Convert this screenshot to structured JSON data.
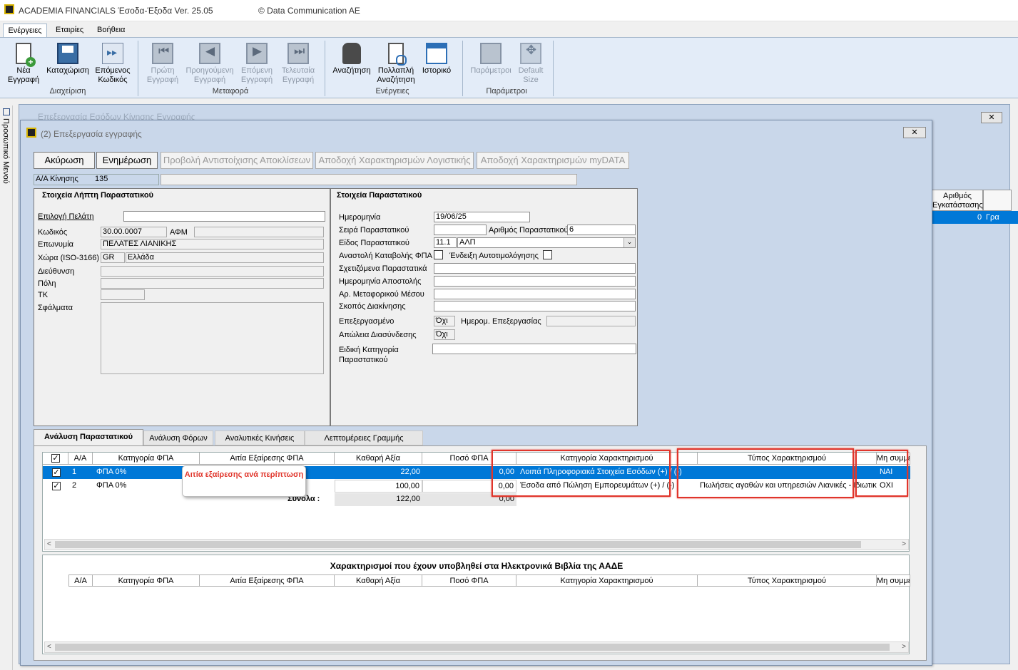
{
  "window": {
    "app_title": "ACADEMIA FINANCIALS Έσοδα-Έξοδα Ver. 25.05",
    "copyright": "© Data Communication AE"
  },
  "menu_tabs": [
    "Ενέργειες",
    "Εταιρίες",
    "Βοήθεια"
  ],
  "ribbon": {
    "new_record": [
      "Νέα",
      "Εγγραφή"
    ],
    "save": "Καταχώριση",
    "next_code": [
      "Επόμενος",
      "Κωδικός"
    ],
    "group_management": "Διαχείριση",
    "first": [
      "Πρώτη",
      "Εγγραφή"
    ],
    "previous": [
      "Προηγούμενη",
      "Εγγραφή"
    ],
    "next": [
      "Επόμενη",
      "Εγγραφή"
    ],
    "last": [
      "Τελευταία",
      "Εγγραφή"
    ],
    "group_navigation": "Μεταφορά",
    "search": "Αναζήτηση",
    "multi_search": [
      "Πολλαπλή",
      "Αναζήτηση"
    ],
    "history": "Ιστορικό",
    "group_actions": "Ενέργειες",
    "parameters": "Παράμετροι",
    "default_size": [
      "Default",
      "Size"
    ],
    "group_parameters": "Παράμετροι"
  },
  "sidebar": {
    "label": "Προσωπικό Μενού"
  },
  "background_window": {
    "title": "Επεξεργασία Εσόδων Κίνησης Εγγραφής",
    "col_header": [
      "Αριθμός",
      "Εγκατάστασης"
    ],
    "row_value": "0",
    "row_extra": "Γρα"
  },
  "edit_window": {
    "title": "(2) Επεξεργασία εγγραφής",
    "buttons": {
      "cancel": "Ακύρωση",
      "update": "Ενημέρωση",
      "view_matching": "Προβολή Αντιστοίχισης Αποκλίσεων",
      "accept_accounting": "Αποδοχή Χαρακτηρισμών Λογιστικής",
      "accept_mydata": "Αποδοχή Χαρακτηρισμών myDATA"
    },
    "movement_label": "Α/Α Κίνησης",
    "movement_value": "135",
    "recipient": {
      "title": "Στοιχεία Λήπτη Παραστατικού",
      "select_customer": "Επιλογή Πελάτη",
      "code_label": "Κωδικός",
      "code": "30.00.0007",
      "afm_label": "ΑΦΜ",
      "name_label": "Επωνυμία",
      "name": "ΠΕΛΑΤΕΣ ΛΙΑΝΙΚΗΣ",
      "country_label": "Χώρα (ISO-3166)",
      "country_code": "GR",
      "country": "Ελλάδα",
      "address_label": "Διεύθυνση",
      "city_label": "Πόλη",
      "zip_label": "ΤΚ",
      "errors_label": "Σφάλματα"
    },
    "document": {
      "title": "Στοιχεία Παραστατικού",
      "date_label": "Ημερομηνία",
      "date": "19/06/25",
      "series_label": "Σειρά Παραστατικού",
      "number_label": "Αριθμός Παραστατικού",
      "number": "6",
      "type_label": "Είδος Παραστατικού",
      "type_code": "11.1",
      "type": "ΑΛΠ",
      "vat_suspension_label": "Αναστολή Καταβολής ΦΠΑ",
      "self_billing_label": "Ένδειξη Αυτοτιμολόγησης",
      "related_label": "Σχετιζόμενα Παραστατικά",
      "ship_date_label": "Ημερομηνία Αποστολής",
      "vehicle_label": "Αρ. Μεταφορικού Μέσου",
      "purpose_label": "Σκοπός Διακίνησης",
      "processed_label": "Επεξεργασμένο",
      "processed": "Όχι",
      "process_date_label": "Ημερομ. Επεξεργασίας",
      "loss_label": "Απώλεια Διασύνδεσης",
      "loss": "Όχι",
      "special_label": [
        "Ειδική Κατηγορία",
        "Παραστατικού"
      ]
    },
    "tabs": [
      "Ανάλυση Παραστατικού",
      "Ανάλυση Φόρων",
      "Αναλυτικές Κινήσεις",
      "Λεπτομέρειες Γραμμής"
    ],
    "lines_grid": {
      "headers": [
        "Α/Α",
        "Κατηγορία ΦΠΑ",
        "Αιτία Εξαίρεσης ΦΠΑ",
        "Καθαρή Αξία",
        "Ποσό ΦΠΑ",
        "Κατηγορία Χαρακτηρισμού",
        "Τύπος Χαρακτηρισμού",
        "Μη συμμετοχή"
      ],
      "rows": [
        {
          "aa": "1",
          "vat_cat": "ΦΠΑ  0%",
          "net": "22,00",
          "vat": "0,00",
          "char_cat": "Λοιπά Πληροφοριακά Στοιχεία Εσόδων (+) / (-)",
          "char_type": "",
          "exclude": "ΝΑΙ"
        },
        {
          "aa": "2",
          "vat_cat": "ΦΠΑ  0%",
          "net": "100,00",
          "vat": "0,00",
          "char_cat": "Έσοδα από Πώληση Εμπορευμάτων (+) / (-)",
          "char_type": "Πωλήσεις αγαθών και υπηρεσιών Λιανικές - Ιδιωτικ",
          "exclude": "ΟΧΙ"
        }
      ],
      "totals_label": "Σύνολα :",
      "total_net": "122,00",
      "total_vat": "0,00"
    },
    "callout": "Αιτία εξαίρεσης ανά περίπτωση",
    "submitted_grid": {
      "title": "Χαρακτηρισμοί που έχουν υποβληθεί στα Ηλεκτρονικά Βιβλία της ΑΑΔΕ",
      "headers": [
        "Α/Α",
        "Κατηγορία ΦΠΑ",
        "Αιτία Εξαίρεσης ΦΠΑ",
        "Καθαρή Αξία",
        "Ποσό ΦΠΑ",
        "Κατηγορία Χαρακτηρισμού",
        "Τύπος Χαρακτηρισμού",
        "Μη συμμετοχή"
      ]
    }
  },
  "colors": {
    "accent": "#0078d7",
    "highlight": "#e0352b",
    "window_bg": "#c9d7ea"
  }
}
